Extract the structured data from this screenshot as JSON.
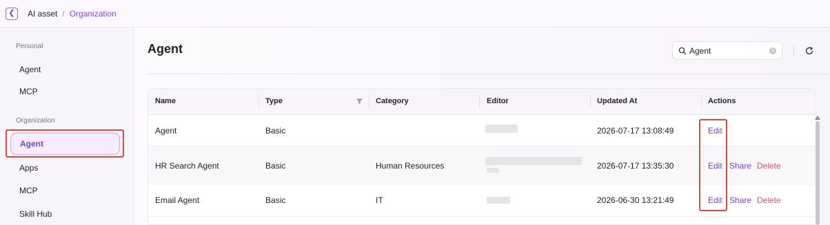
{
  "breadcrumb": {
    "root": "AI asset",
    "separator": "/",
    "current": "Organization"
  },
  "sidebar": {
    "personal_label": "Personal",
    "personal_items": [
      "Agent",
      "MCP"
    ],
    "org_label": "Organization",
    "org_items": [
      "Agent",
      "Apps",
      "MCP",
      "Skill Hub"
    ],
    "active_item": "Agent"
  },
  "main": {
    "title": "Agent",
    "search": {
      "value": "Agent",
      "placeholder": ""
    }
  },
  "table": {
    "columns": [
      "Name",
      "Type",
      "Category",
      "Editor",
      "Updated At",
      "Actions"
    ],
    "rows": [
      {
        "name": "Agent",
        "type": "Basic",
        "category": "",
        "updated_at": "2026-07-17 13:08:49",
        "actions": [
          "Edit"
        ]
      },
      {
        "name": "HR Search Agent",
        "type": "Basic",
        "category": "Human Resources",
        "updated_at": "2026-07-17 13:35:30",
        "actions": [
          "Edit",
          "Share",
          "Delete"
        ]
      },
      {
        "name": "Email Agent",
        "type": "Basic",
        "category": "IT",
        "updated_at": "2026-06-30 13:21:49",
        "actions": [
          "Edit",
          "Share",
          "Delete"
        ]
      }
    ]
  },
  "colors": {
    "accent": "#7a3fd0",
    "danger": "#e05560",
    "highlight_box": "#e0473a"
  },
  "icons": [
    "back-icon",
    "search-icon",
    "clear-icon",
    "refresh-icon",
    "filter-icon"
  ]
}
